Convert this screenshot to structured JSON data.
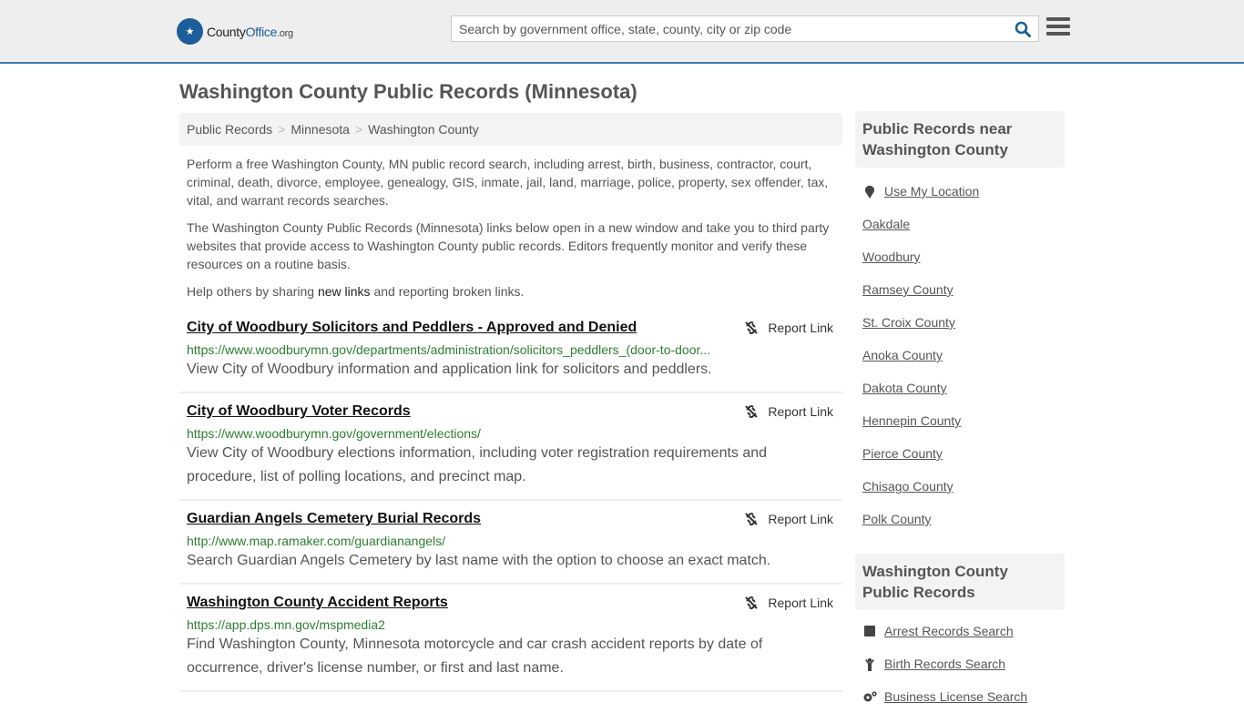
{
  "header": {
    "logo": {
      "name": "County",
      "office": "Office",
      "tld": ".org"
    },
    "search": {
      "placeholder": "Search by government office, state, county, city or zip code",
      "value": ""
    },
    "search_icon": "search-icon",
    "menu_icon": "hamburger-menu-icon"
  },
  "page": {
    "title": "Washington County Public Records (Minnesota)",
    "breadcrumb": [
      "Public Records",
      "Minnesota",
      "Washington County"
    ],
    "intro": [
      "Perform a free Washington County, MN public record search, including arrest, birth, business, contractor, court, criminal, death, divorce, employee, genealogy, GIS, inmate, jail, land, marriage, police, property, sex offender, tax, vital, and warrant records searches.",
      "The Washington County Public Records (Minnesota) links below open in a new window and take you to third party websites that provide access to Washington County public records. Editors frequently monitor and verify these resources on a routine basis."
    ],
    "share": {
      "before": "Help others by sharing ",
      "link": "new links",
      "after": " and reporting broken links."
    }
  },
  "results": [
    {
      "title": "City of Woodbury Solicitors and Peddlers - Approved and Denied",
      "url": "https://www.woodburymn.gov/departments/administration/solicitors_peddlers_(door-to-door...",
      "desc": "View City of Woodbury information and application link for solicitors and peddlers.",
      "report": "Report Link"
    },
    {
      "title": "City of Woodbury Voter Records",
      "url": "https://www.woodburymn.gov/government/elections/",
      "desc": "View City of Woodbury elections information, including voter registration requirements and procedure, list of polling locations, and precinct map.",
      "report": "Report Link"
    },
    {
      "title": "Guardian Angels Cemetery Burial Records",
      "url": "http://www.map.ramaker.com/guardianangels/",
      "desc": "Search Guardian Angels Cemetery by last name with the option to choose an exact match.",
      "report": "Report Link"
    },
    {
      "title": "Washington County Accident Reports",
      "url": "https://app.dps.mn.gov/mspmedia2",
      "desc": "Find Washington County, Minnesota motorcycle and car crash accident reports by date of occurrence, driver's license number, or first and last name.",
      "report": "Report Link"
    }
  ],
  "sidebar": {
    "nearby": {
      "heading": "Public Records near Washington County",
      "use_location": "Use My Location",
      "items": [
        "Oakdale",
        "Woodbury",
        "Ramsey County",
        "St. Croix County",
        "Anoka County",
        "Dakota County",
        "Hennepin County",
        "Pierce County",
        "Chisago County",
        "Polk County"
      ]
    },
    "records": {
      "heading": "Washington County Public Records",
      "items": [
        {
          "label": "Arrest Records Search",
          "icon": "square-icon"
        },
        {
          "label": "Birth Records Search",
          "icon": "child-icon"
        },
        {
          "label": "Business License Search",
          "icon": "cogs-icon"
        }
      ]
    }
  }
}
